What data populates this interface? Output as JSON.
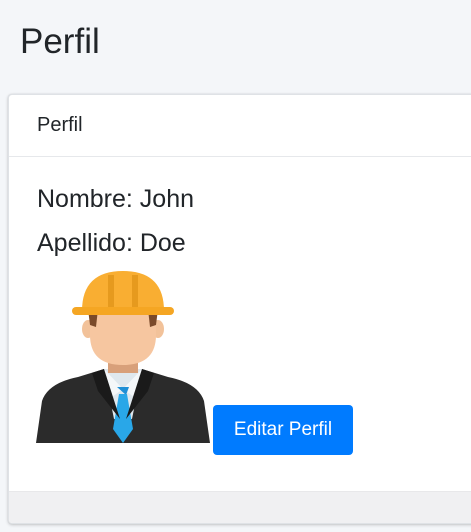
{
  "page": {
    "title": "Perfil"
  },
  "card": {
    "header_title": "Perfil",
    "name_line": "Nombre: John",
    "lastname_line": "Apellido: Doe",
    "edit_button_label": "Editar Perfil"
  },
  "icons": {
    "avatar": "worker-hardhat-avatar-icon"
  },
  "colors": {
    "primary": "#007bff",
    "page_background": "#f4f6f9",
    "hardhat": "#f9ae32"
  }
}
